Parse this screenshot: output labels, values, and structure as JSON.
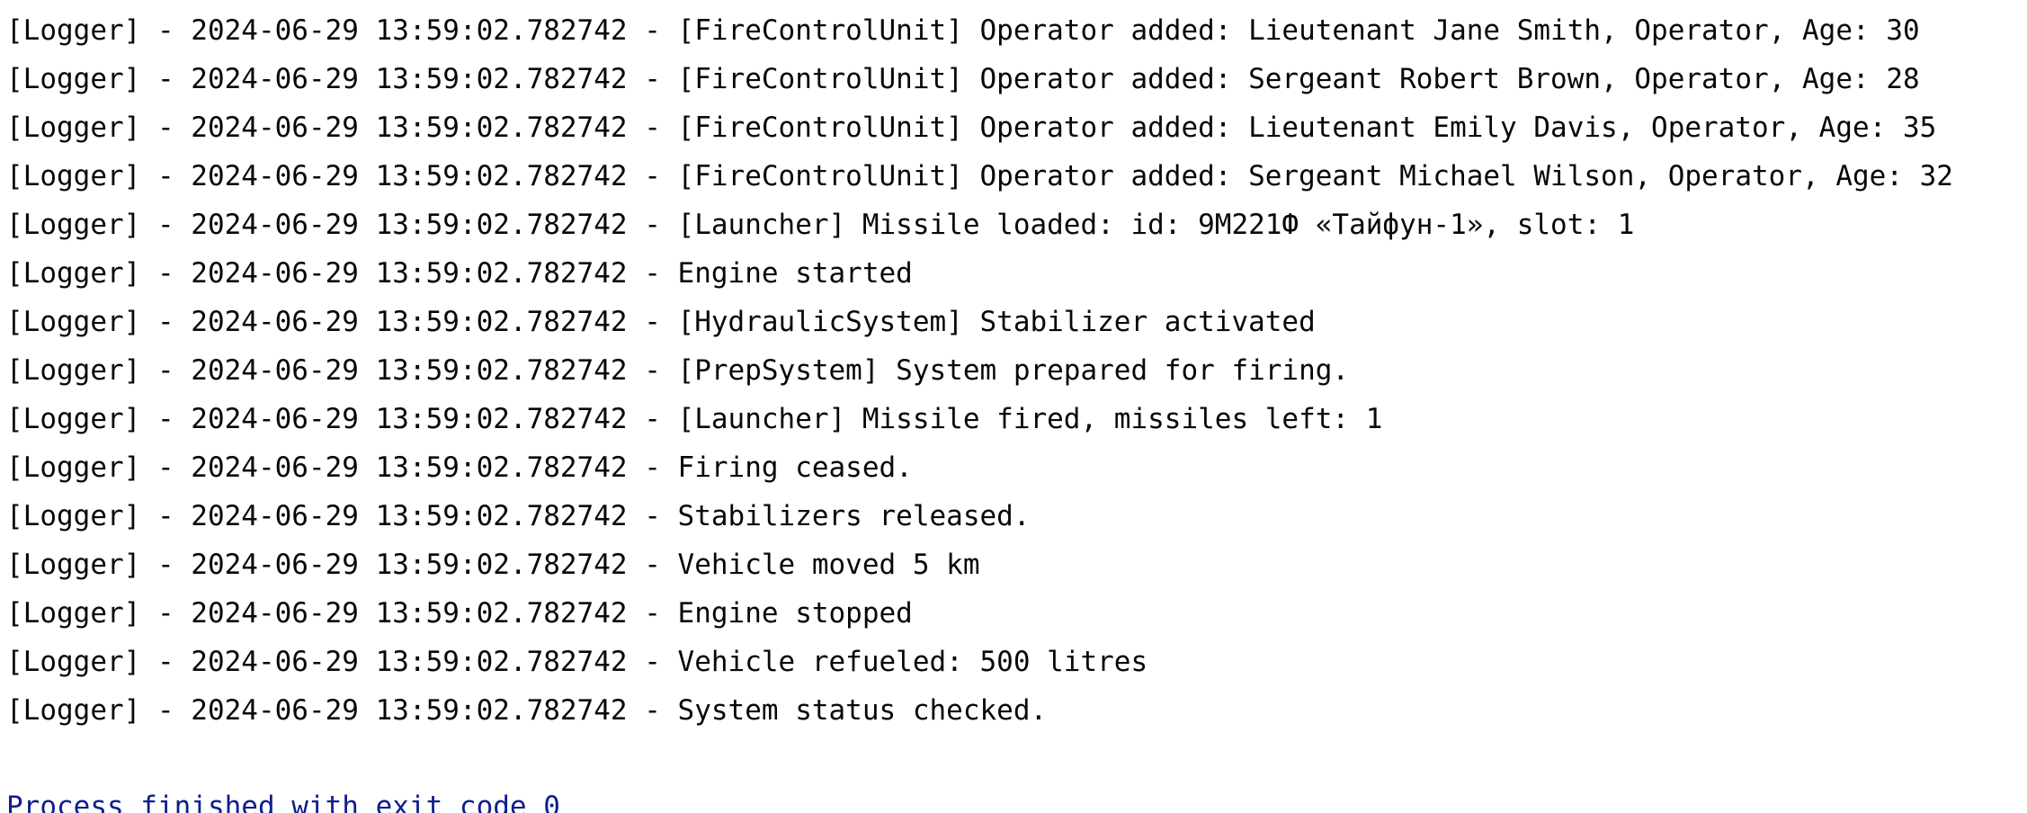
{
  "console": {
    "lines": [
      "[Logger] - 2024-06-29 13:59:02.782742 - [FireControlUnit] Operator added: Lieutenant Jane Smith, Operator, Age: 30",
      "[Logger] - 2024-06-29 13:59:02.782742 - [FireControlUnit] Operator added: Sergeant Robert Brown, Operator, Age: 28",
      "[Logger] - 2024-06-29 13:59:02.782742 - [FireControlUnit] Operator added: Lieutenant Emily Davis, Operator, Age: 35",
      "[Logger] - 2024-06-29 13:59:02.782742 - [FireControlUnit] Operator added: Sergeant Michael Wilson, Operator, Age: 32",
      "[Logger] - 2024-06-29 13:59:02.782742 - [Launcher] Missile loaded: id: 9М221Ф «Тайфун-1», slot: 1",
      "[Logger] - 2024-06-29 13:59:02.782742 - Engine started",
      "[Logger] - 2024-06-29 13:59:02.782742 - [HydraulicSystem] Stabilizer activated",
      "[Logger] - 2024-06-29 13:59:02.782742 - [PrepSystem] System prepared for firing.",
      "[Logger] - 2024-06-29 13:59:02.782742 - [Launcher] Missile fired, missiles left: 1",
      "[Logger] - 2024-06-29 13:59:02.782742 - Firing ceased.",
      "[Logger] - 2024-06-29 13:59:02.782742 - Stabilizers released.",
      "[Logger] - 2024-06-29 13:59:02.782742 - Vehicle moved 5 km",
      "[Logger] - 2024-06-29 13:59:02.782742 - Engine stopped",
      "[Logger] - 2024-06-29 13:59:02.782742 - Vehicle refueled: 500 litres",
      "[Logger] - 2024-06-29 13:59:02.782742 - System status checked."
    ],
    "exit_message": "Process finished with exit code 0"
  },
  "colors": {
    "background": "#ffffff",
    "text": "#080808",
    "exit_message": "#0f1d8c"
  }
}
